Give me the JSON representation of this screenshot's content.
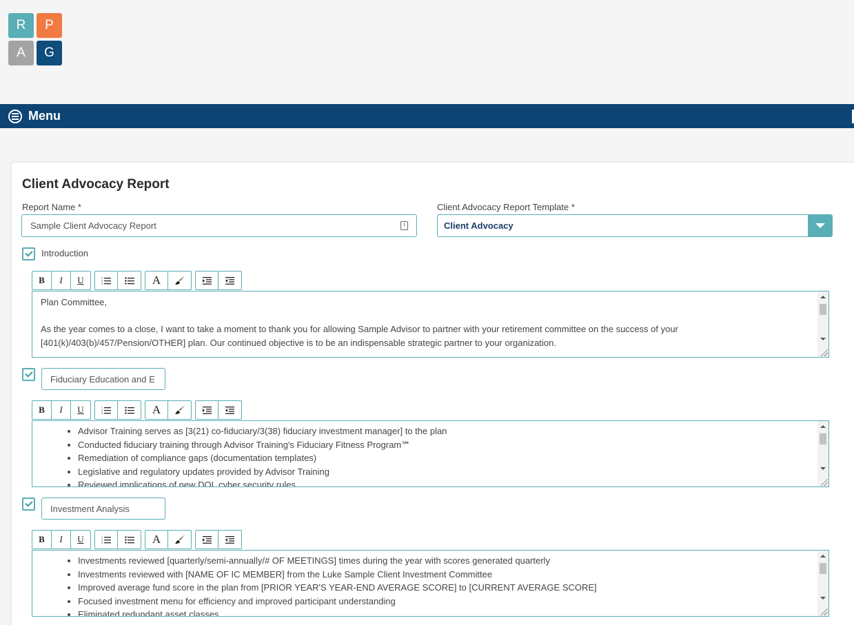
{
  "logo": {
    "letters": [
      "R",
      "P",
      "A",
      "G"
    ],
    "colors": [
      "#5aaeb6",
      "#f07a42",
      "#a4a4a4",
      "#0f4d7c"
    ]
  },
  "menu": {
    "label": "Menu",
    "icon": "menu-circle-icon",
    "bar_color": "#0d4474"
  },
  "page": {
    "title": "Client Advocacy Report"
  },
  "report_name": {
    "label": "Report Name *",
    "value": "Sample Client Advocacy Report",
    "icon": "info-icon"
  },
  "template": {
    "label": "Client Advocacy Report Template *",
    "value": "Client Advocacy",
    "icon": "dropdown-caret-icon"
  },
  "toolbar": {
    "bold": "B",
    "italic": "I",
    "underline": "U",
    "ordered_list_icon": "ordered-list-icon",
    "unordered_list_icon": "bullet-list-icon",
    "font_color": "A",
    "highlight_icon": "brush-icon",
    "indent_icon": "indent-icon",
    "outdent_icon": "outdent-icon"
  },
  "sections": [
    {
      "checked": true,
      "title": "Introduction",
      "paragraphs": [
        "Plan Committee,",
        "",
        "As the year comes to a close, I want to take a moment to thank you for allowing Sample Advisor to partner with your retirement committee on the success of your",
        "[401(k)/403(b)/457/Pension/OTHER] plan. Our continued objective is to be an indispensable strategic partner to your organization."
      ]
    },
    {
      "checked": true,
      "title": "Fiduciary Education and E",
      "bullets": [
        "Advisor Training  serves as [3(21) co-fiduciary/3(38) fiduciary investment manager] to the plan",
        "Conducted fiduciary training through Advisor Training's Fiduciary Fitness Program℠",
        "Remediation of compliance gaps (documentation templates)",
        "Legislative and regulatory updates provided by Advisor Training",
        "Reviewed implications of new DOL cyber security rules"
      ]
    },
    {
      "checked": true,
      "title": "Investment Analysis",
      "bullets": [
        "Investments reviewed [quarterly/semi-annually/# OF MEETINGS] times during the year with scores generated quarterly",
        "Investments reviewed with [NAME OF IC MEMBER] from the Luke Sample Client Investment Committee",
        "Improved average fund score in the plan from [PRIOR YEAR'S YEAR-END AVERAGE SCORE] to [CURRENT AVERAGE SCORE]",
        "Focused investment menu for efficiency and improved participant understanding",
        "Eliminated redundant asset classes"
      ]
    }
  ]
}
